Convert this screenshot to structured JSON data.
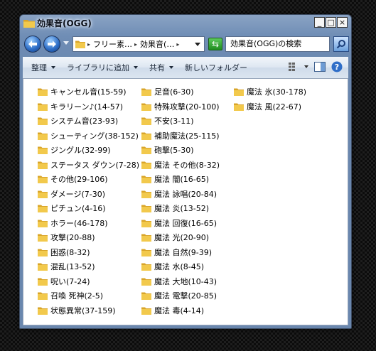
{
  "window": {
    "title": "効果音(OGG)",
    "controls": {
      "minimize": "_",
      "maximize": "□",
      "close": "×"
    }
  },
  "address_bar": {
    "segments": [
      "フリー素…",
      "効果音(…"
    ],
    "search_placeholder": "効果音(OGG)の検索"
  },
  "toolbar": {
    "organize": "整理",
    "library": "ライブラリに追加",
    "share": "共有",
    "new_folder": "新しいフォルダー"
  },
  "folders": {
    "col1": [
      "キャンセル音(15-59)",
      "キラリーン♪(14-57)",
      "システム音(23-93)",
      "シューティング(38-152)",
      "ジングル(32-99)",
      "ステータス ダウン(7-28)",
      "その他(29-106)",
      "ダメージ(7-30)",
      "ピチュン(4-16)",
      "ホラー(46-178)",
      "攻撃(20-88)",
      "困惑(8-32)",
      "混乱(13-52)",
      "呪い(7-24)",
      "召喚 死神(2-5)",
      "状態異常(37-159)"
    ],
    "col2": [
      "足音(6-30)",
      "特殊攻撃(20-100)",
      "不安(3-11)",
      "補助魔法(25-115)",
      "砲撃(5-30)",
      "魔法 その他(8-32)",
      "魔法 闇(16-65)",
      "魔法 詠唱(20-84)",
      "魔法 炎(13-52)",
      "魔法 回復(16-65)",
      "魔法 光(20-90)",
      "魔法 自然(9-39)",
      "魔法 水(8-45)",
      "魔法 大地(10-43)",
      "魔法 電撃(20-85)",
      "魔法 毒(4-14)"
    ],
    "col3": [
      "魔法 氷(30-178)",
      "魔法 風(22-67)"
    ]
  },
  "colors": {
    "folder": "#f2c94c",
    "folder_dark": "#d9a52a",
    "window_frame": "#6f8db5",
    "background": "#0c0c0c"
  },
  "icons": [
    "folder-icon",
    "back-arrow-icon",
    "forward-arrow-icon",
    "refresh-icon",
    "search-icon",
    "view-options-icon",
    "preview-pane-icon",
    "help-icon"
  ]
}
